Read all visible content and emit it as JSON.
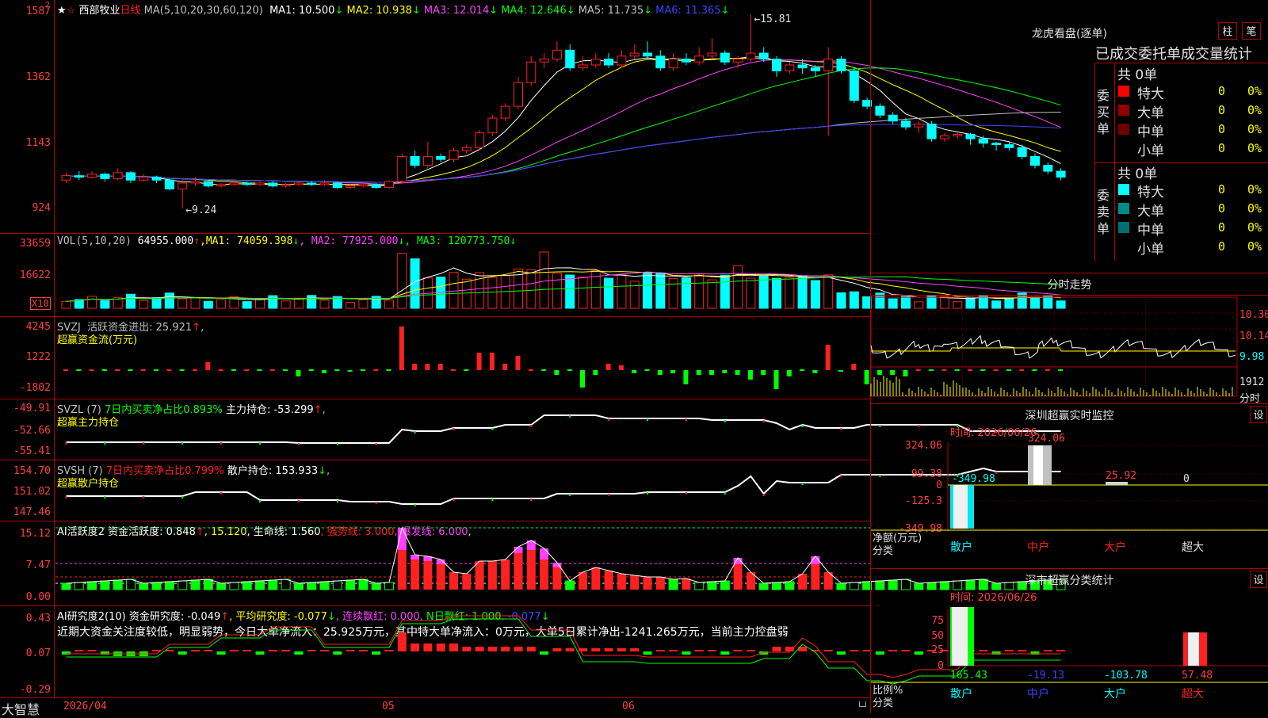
{
  "app": {
    "brand": "大智慧",
    "date_label": "2026/04",
    "month_labels": [
      "05",
      "06"
    ]
  },
  "kline": {
    "title": "西部牧业",
    "period": "日线",
    "ma_header": "MA(5,10,20,30,60,120)",
    "ma": [
      {
        "text": "MA1: 10.500",
        "arrow": "↓",
        "color": "#ffffff"
      },
      {
        "text": "MA2: 10.938",
        "arrow": "↓",
        "color": "#ffff00"
      },
      {
        "text": "MA3: 12.014",
        "arrow": "↓",
        "color": "#ff40ff"
      },
      {
        "text": "MA4: 12.646",
        "arrow": "↓",
        "color": "#00ff00"
      },
      {
        "text": "MA5: 11.735",
        "arrow": "↓",
        "color": "#c0c0c0"
      },
      {
        "text": "MA6: 11.365",
        "arrow": "↓",
        "color": "#4040ff"
      }
    ],
    "axis": [
      "1587",
      "1362",
      "1143",
      "924"
    ],
    "high_label": "15.81",
    "low_label": "9.24",
    "candles": [
      [
        10.2,
        10.35,
        10.45,
        10.1
      ],
      [
        10.35,
        10.3,
        10.5,
        10.2
      ],
      [
        10.3,
        10.4,
        10.5,
        10.25
      ],
      [
        10.4,
        10.25,
        10.45,
        10.15
      ],
      [
        10.25,
        10.45,
        10.6,
        10.2
      ],
      [
        10.45,
        10.2,
        10.5,
        10.1
      ],
      [
        10.2,
        10.3,
        10.4,
        10.15
      ],
      [
        10.3,
        10.2,
        10.35,
        10.1
      ],
      [
        10.2,
        9.9,
        10.25,
        9.85
      ],
      [
        9.9,
        10.1,
        10.2,
        9.24
      ],
      [
        10.1,
        10.15,
        10.3,
        10.0
      ],
      [
        10.15,
        10.0,
        10.2,
        9.95
      ],
      [
        10.0,
        10.05,
        10.1,
        9.95
      ],
      [
        10.05,
        10.1,
        10.15,
        10.0
      ],
      [
        10.1,
        10.05,
        10.15,
        10.0
      ],
      [
        10.05,
        10.1,
        10.15,
        10.0
      ],
      [
        10.1,
        10.0,
        10.15,
        9.95
      ],
      [
        10.0,
        10.05,
        10.1,
        9.95
      ],
      [
        10.05,
        10.1,
        10.15,
        10.0
      ],
      [
        10.1,
        10.05,
        10.15,
        10.0
      ],
      [
        10.05,
        10.1,
        10.2,
        10.0
      ],
      [
        10.1,
        9.95,
        10.15,
        9.9
      ],
      [
        9.95,
        10.0,
        10.05,
        9.9
      ],
      [
        10.0,
        10.05,
        10.1,
        9.95
      ],
      [
        10.05,
        9.95,
        10.1,
        9.9
      ],
      [
        9.95,
        10.15,
        10.2,
        9.9
      ],
      [
        10.15,
        11.0,
        11.1,
        10.1
      ],
      [
        11.0,
        10.7,
        11.2,
        10.6
      ],
      [
        10.7,
        11.0,
        11.5,
        10.6
      ],
      [
        11.0,
        10.9,
        11.1,
        10.8
      ],
      [
        10.9,
        11.2,
        11.3,
        10.8
      ],
      [
        11.2,
        11.3,
        11.4,
        11.1
      ],
      [
        11.3,
        11.8,
        11.9,
        11.2
      ],
      [
        11.8,
        12.3,
        12.4,
        11.7
      ],
      [
        12.3,
        12.7,
        12.8,
        12.2
      ],
      [
        12.7,
        13.5,
        13.7,
        12.6
      ],
      [
        13.5,
        14.2,
        14.4,
        13.4
      ],
      [
        14.2,
        14.3,
        14.5,
        14.0
      ],
      [
        14.3,
        14.6,
        14.9,
        14.2
      ],
      [
        14.6,
        14.0,
        14.8,
        13.9
      ],
      [
        14.0,
        14.1,
        14.4,
        13.9
      ],
      [
        14.1,
        14.3,
        14.5,
        14.0
      ],
      [
        14.3,
        14.1,
        14.5,
        14.0
      ],
      [
        14.1,
        14.4,
        14.6,
        14.0
      ],
      [
        14.4,
        14.5,
        14.8,
        14.3
      ],
      [
        14.5,
        14.4,
        14.9,
        14.3
      ],
      [
        14.4,
        14.0,
        14.6,
        13.9
      ],
      [
        14.0,
        14.3,
        14.5,
        13.9
      ],
      [
        14.3,
        14.2,
        14.5,
        14.1
      ],
      [
        14.2,
        14.4,
        14.7,
        14.1
      ],
      [
        14.4,
        14.5,
        15.0,
        14.3
      ],
      [
        14.5,
        14.2,
        14.6,
        14.1
      ],
      [
        14.2,
        14.3,
        14.4,
        14.0
      ],
      [
        14.3,
        14.5,
        15.81,
        14.2
      ],
      [
        14.5,
        14.3,
        14.7,
        14.2
      ],
      [
        14.3,
        13.9,
        14.4,
        13.7
      ],
      [
        13.9,
        14.1,
        14.2,
        13.8
      ],
      [
        14.1,
        14.0,
        14.3,
        13.8
      ],
      [
        14.0,
        13.9,
        14.1,
        13.7
      ],
      [
        13.9,
        14.3,
        14.7,
        11.7
      ],
      [
        14.3,
        13.9,
        14.4,
        13.8
      ],
      [
        13.9,
        12.9,
        14.0,
        12.8
      ],
      [
        12.9,
        12.7,
        13.0,
        12.6
      ],
      [
        12.7,
        12.4,
        12.8,
        12.3
      ],
      [
        12.4,
        12.2,
        12.5,
        12.1
      ],
      [
        12.2,
        12.0,
        12.3,
        11.9
      ],
      [
        12.0,
        12.1,
        12.2,
        11.8
      ],
      [
        12.1,
        11.6,
        12.2,
        11.5
      ],
      [
        11.6,
        11.7,
        11.8,
        11.5
      ],
      [
        11.7,
        11.75,
        11.8,
        11.6
      ],
      [
        11.75,
        11.6,
        11.8,
        11.4
      ],
      [
        11.6,
        11.45,
        11.7,
        11.3
      ],
      [
        11.45,
        11.4,
        11.5,
        11.2
      ],
      [
        11.4,
        11.3,
        11.5,
        11.2
      ],
      [
        11.3,
        11.0,
        11.4,
        10.9
      ],
      [
        11.0,
        10.7,
        11.1,
        10.6
      ],
      [
        10.7,
        10.5,
        10.8,
        10.4
      ],
      [
        10.5,
        10.3,
        10.6,
        10.2
      ]
    ]
  },
  "vol": {
    "header": [
      {
        "text": "VOL(5,10,20)",
        "color": "#c0c0c0"
      },
      {
        "text": " 64955.000",
        "arrow": "↑",
        "color": "#ffffff"
      },
      {
        "text": ",MA1: 74059.398",
        "arrow": "↓",
        "color": "#ffff00"
      },
      {
        "text": ", MA2: 77925.000",
        "arrow": "↓",
        "color": "#ff40ff"
      },
      {
        "text": ", MA3: 120773.750",
        "arrow": "↓",
        "color": "#00ff00"
      }
    ],
    "axis": [
      "33659",
      "16622"
    ],
    "unit": "X10"
  },
  "svzj": {
    "header": [
      {
        "text": "SVZJ  活跃资金进出: 25.921",
        "arrow": "↑",
        "color": "#c0c0c0"
      },
      {
        "text": ",",
        "color": "#c0c0c0"
      }
    ],
    "sub": "超赢资金流(万元)",
    "axis": [
      "4245",
      "1222",
      "-1802"
    ]
  },
  "svzl": {
    "header": [
      {
        "text": "SVZL (7) ",
        "color": "#c0c0c0"
      },
      {
        "text": "7日内买卖净占比0.893%",
        "color": "#00ff00"
      },
      {
        "text": " 主力持仓: -53.299",
        "arrow": "↑",
        "color": "#ffffff"
      },
      {
        "text": ",",
        "color": "#c0c0c0"
      }
    ],
    "sub": "超赢主力持仓",
    "axis": [
      "-49.91",
      "-52.66",
      "-55.41"
    ]
  },
  "svsh": {
    "header": [
      {
        "text": "SVSH (7) ",
        "color": "#c0c0c0"
      },
      {
        "text": "7日内买卖净占比0.799%",
        "color": "#ff2020"
      },
      {
        "text": " 散户持仓: 153.933",
        "arrow": "↓",
        "color": "#ffffff"
      },
      {
        "text": ",",
        "color": "#c0c0c0"
      }
    ],
    "sub": "超赢散户持仓",
    "axis": [
      "154.70",
      "151.02",
      "147.46"
    ]
  },
  "ai1": {
    "header": [
      {
        "text": "AI活跃度2 资金活跃度: 0.848",
        "arrow": "↑",
        "color": "#ffffff"
      },
      {
        "text": ", 15.120",
        "color": "#ffff00"
      },
      {
        "text": ", 生命线: 1.560",
        "color": "#ffffff"
      },
      {
        "text": ", 强势线: 3.000",
        "color": "#ff2020"
      },
      {
        "text": ", 爆发线: 6.000",
        "color": "#ff40ff"
      },
      {
        "text": ",",
        "color": "#c0c0c0"
      }
    ],
    "axis": [
      "15.12",
      "7.47",
      "0.00"
    ]
  },
  "ai2": {
    "header": [
      {
        "text": "AI研究度2(10) 资金研究度: -0.049",
        "arrow": "↑",
        "color": "#ffffff"
      },
      {
        "text": ", 平均研究度: -0.077",
        "arrow": "↓",
        "color": "#ffff00"
      },
      {
        "text": ", 连续飘红: 0.000",
        "color": "#ff40ff"
      },
      {
        "text": ", N日飘红: 1.000",
        "color": "#00ff00"
      },
      {
        "text": ", -0.077",
        "arrow": "↓",
        "color": "#4040ff"
      }
    ],
    "comment": "近期大资金关注度较低，明显弱势，今日大单净流入：25.925万元，其中特大单净流入：0万元，大单5日累计净出-1241.265万元，当前主力控盘弱",
    "axis": [
      "0.43",
      "0.07",
      "-0.29"
    ]
  },
  "right": {
    "lhb": {
      "title": "龙虎看盘(逐单)",
      "btn1": "柱",
      "btn2": "笔",
      "table_title": "已成交委托单成交量统计",
      "buy": {
        "side": "委买单",
        "total": "共 0单",
        "rows": [
          {
            "label": "特大",
            "count": "0",
            "pct": "0%",
            "color": "#ff0000"
          },
          {
            "label": "大单",
            "count": "0",
            "pct": "0%",
            "color": "#900000"
          },
          {
            "label": "中单",
            "count": "0",
            "pct": "0%",
            "color": "#700000"
          },
          {
            "label": "小单",
            "count": "0",
            "pct": "0%",
            "color": ""
          }
        ]
      },
      "sell": {
        "side": "委卖单",
        "total": "共 0单",
        "rows": [
          {
            "label": "特大",
            "count": "0",
            "pct": "0%",
            "color": "#00ffff"
          },
          {
            "label": "大单",
            "count": "0",
            "pct": "0%",
            "color": "#008b8b"
          },
          {
            "label": "中单",
            "count": "0",
            "pct": "0%",
            "color": "#007070"
          },
          {
            "label": "小单",
            "count": "0",
            "pct": "0%",
            "color": ""
          }
        ]
      }
    },
    "intraday": {
      "title": "分时走势",
      "axis": [
        "10.30",
        "10.14",
        "9.98"
      ],
      "vol_label": "1912",
      "vol_unit": "分时"
    },
    "sz_monitor": {
      "title": "深圳超赢实时监控",
      "settings": "设",
      "time": "时间: 2026/06/26",
      "axis": [
        "324.06",
        "99.38",
        "0",
        "-125.3",
        "-349.98"
      ],
      "values": [
        "-349.98",
        "324.06",
        "25.92",
        "0"
      ],
      "net_label": "净额(万元)",
      "cat_label": "分类",
      "categories": [
        "散户",
        "中户",
        "大户",
        "超大"
      ]
    },
    "sz_stats": {
      "title": "深市超赢分类统计",
      "settings": "设",
      "time": "时间: 2026/06/26",
      "axis": [
        "75",
        "50",
        "25",
        "0"
      ],
      "values": [
        "165.43",
        "-19.13",
        "-103.78",
        "57.48"
      ],
      "ratio_label": "比例%",
      "cat_label": "分类",
      "categories": [
        "散户",
        "中户",
        "大户",
        "超大"
      ]
    }
  }
}
